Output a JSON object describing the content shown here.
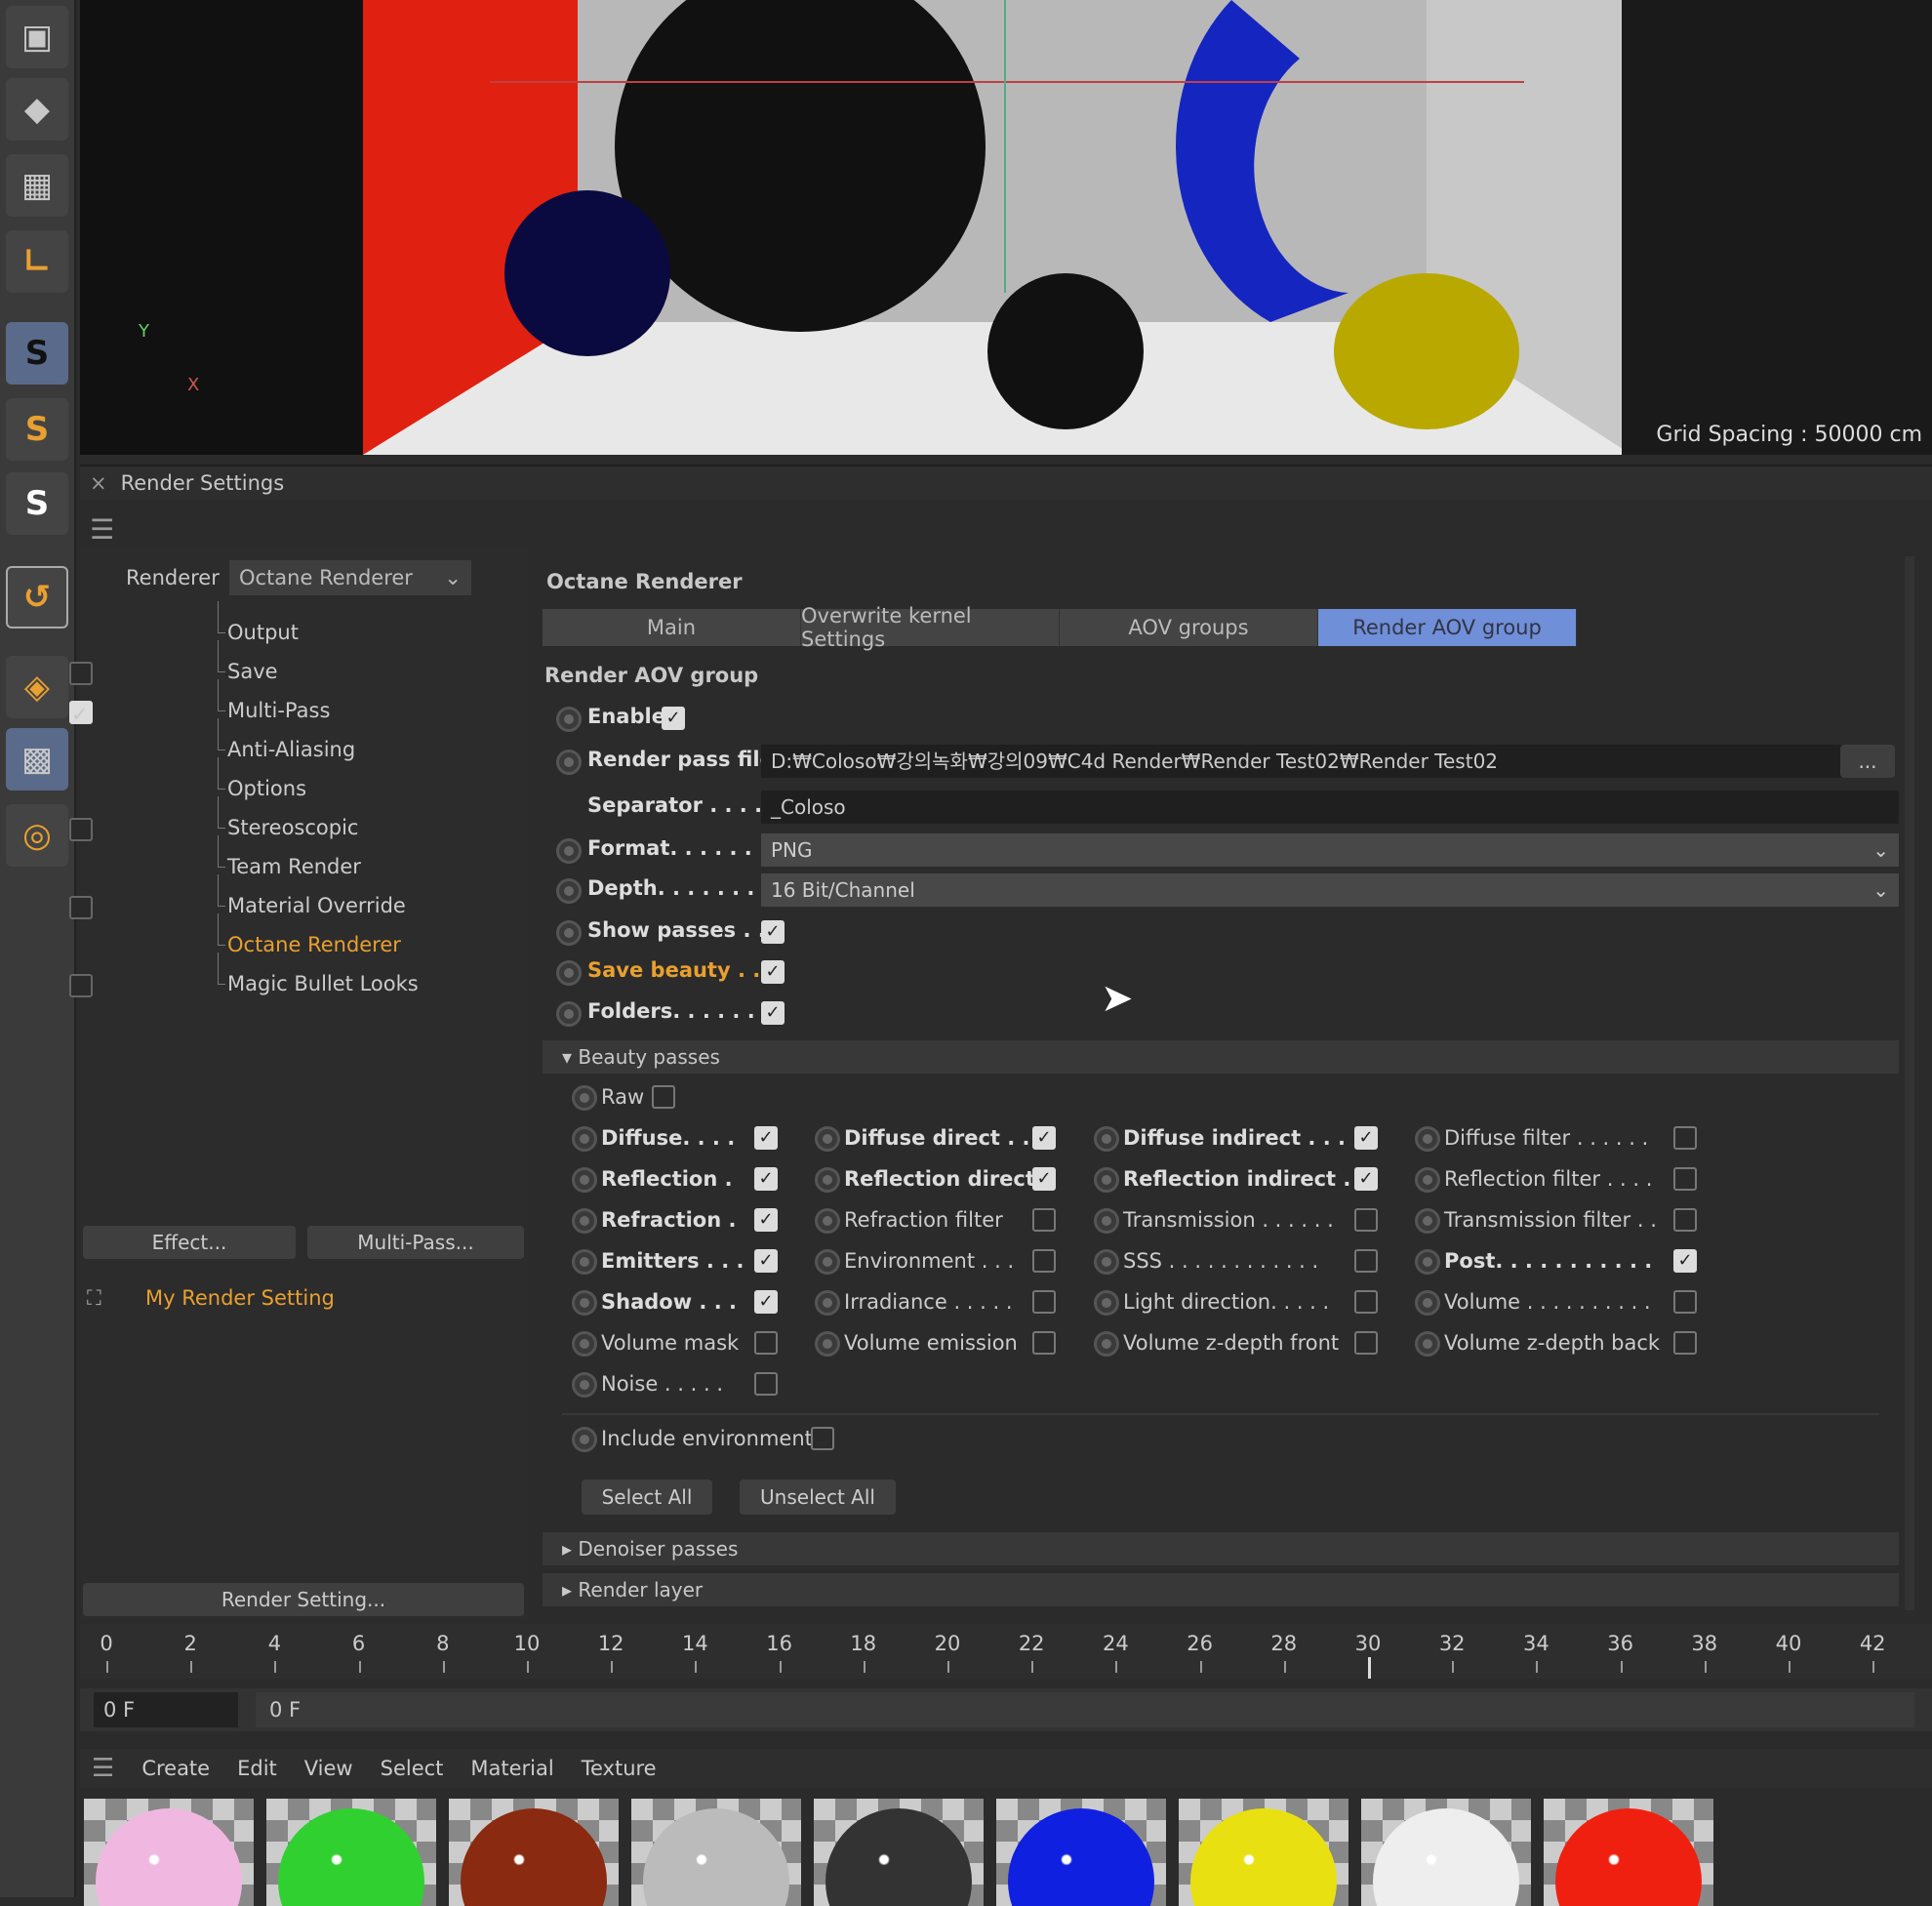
{
  "viewport": {
    "grid_spacing": "Grid Spacing : 50000 cm",
    "axis_x": "X",
    "axis_y": "Y"
  },
  "render_settings": {
    "title": "Render Settings",
    "close": "×",
    "renderer_label": "Renderer",
    "renderer_value": "Octane Renderer",
    "tree": [
      {
        "label": "Output",
        "checkbox": null
      },
      {
        "label": "Save",
        "checkbox": false
      },
      {
        "label": "Multi-Pass",
        "checkbox": true
      },
      {
        "label": "Anti-Aliasing",
        "checkbox": null
      },
      {
        "label": "Options",
        "checkbox": null
      },
      {
        "label": "Stereoscopic",
        "checkbox": false
      },
      {
        "label": "Team Render",
        "checkbox": null
      },
      {
        "label": "Material Override",
        "checkbox": false
      },
      {
        "label": "Octane Renderer",
        "checkbox": null,
        "active": true
      },
      {
        "label": "Magic Bullet Looks",
        "checkbox": false
      }
    ],
    "effect_button": "Effect...",
    "multipass_button": "Multi-Pass...",
    "setting_name": "My Render Setting",
    "render_setting_button": "Render Setting..."
  },
  "octane": {
    "title": "Octane Renderer",
    "tabs": [
      "Main",
      "Overwrite kernel Settings",
      "AOV groups",
      "Render AOV group"
    ],
    "active_tab": 3,
    "section": "Render AOV group",
    "enable": {
      "label": "Enable",
      "checked": true
    },
    "render_pass_file": {
      "label": "Render pass file",
      "value": "D:₩Coloso₩강의녹화₩강의09₩C4d Render₩Render Test02₩Render Test02",
      "browse": "..."
    },
    "separator": {
      "label": "Separator . . . . .",
      "value": "_Coloso"
    },
    "format": {
      "label": "Format. . . . . . .",
      "value": "PNG"
    },
    "depth": {
      "label": "Depth. . . . . . . .",
      "value": "16 Bit/Channel"
    },
    "show_passes": {
      "label": "Show passes . . .",
      "checked": true
    },
    "save_beauty": {
      "label": "Save beauty . . .",
      "checked": true
    },
    "folders": {
      "label": "Folders. . . . . . .",
      "checked": true
    },
    "beauty_title": "Beauty passes",
    "raw": {
      "label": "Raw",
      "checked": false
    },
    "passes": [
      [
        {
          "label": "Diffuse. . . .",
          "checked": true
        },
        {
          "label": "Diffuse direct . .",
          "checked": true
        },
        {
          "label": "Diffuse indirect . . .",
          "checked": true
        },
        {
          "label": "Diffuse filter . . . . . .",
          "checked": false
        }
      ],
      [
        {
          "label": "Reflection .",
          "checked": true
        },
        {
          "label": "Reflection direct",
          "checked": true
        },
        {
          "label": "Reflection indirect .",
          "checked": true
        },
        {
          "label": "Reflection filter . . . .",
          "checked": false
        }
      ],
      [
        {
          "label": "Refraction .",
          "checked": true
        },
        {
          "label": "Refraction filter",
          "checked": false
        },
        {
          "label": "Transmission . . . . . .",
          "checked": false
        },
        {
          "label": "Transmission filter . .",
          "checked": false
        }
      ],
      [
        {
          "label": "Emitters . . .",
          "checked": true
        },
        {
          "label": "Environment . . .",
          "checked": false
        },
        {
          "label": "SSS . . . . . . . . . . . .",
          "checked": false
        },
        {
          "label": "Post. . . . . . . . . . .",
          "checked": true
        }
      ],
      [
        {
          "label": "Shadow . . .",
          "checked": true
        },
        {
          "label": "Irradiance . . . . .",
          "checked": false
        },
        {
          "label": "Light direction. . . . .",
          "checked": false
        },
        {
          "label": "Volume . . . . . . . . . .",
          "checked": false
        }
      ],
      [
        {
          "label": "Volume mask",
          "checked": false
        },
        {
          "label": "Volume emission",
          "checked": false
        },
        {
          "label": "Volume z-depth front",
          "checked": false
        },
        {
          "label": "Volume z-depth back",
          "checked": false
        }
      ],
      [
        {
          "label": "Noise . . . . .",
          "checked": false
        }
      ]
    ],
    "include_env": {
      "label": "Include environment",
      "checked": false
    },
    "select_all": "Select All",
    "unselect_all": "Unselect All",
    "denoiser": "Denoiser passes",
    "render_layer": "Render layer"
  },
  "timeline": {
    "ticks": [
      "0",
      "2",
      "4",
      "6",
      "8",
      "10",
      "12",
      "14",
      "16",
      "18",
      "20",
      "22",
      "24",
      "26",
      "28",
      "30",
      "32",
      "34",
      "36",
      "38",
      "40",
      "42"
    ],
    "current_frame": "0 F",
    "frame_display": "0 F"
  },
  "materials": {
    "menu": [
      "Create",
      "Edit",
      "View",
      "Select",
      "Material",
      "Texture"
    ],
    "swatches": [
      "#f0b8e0",
      "#30d030",
      "#8a2a10",
      "#bbbbbb",
      "#333333",
      "#1020e0",
      "#e8e010",
      "#eeeeee",
      "#f02010"
    ]
  },
  "colors": {
    "accent": "#f0a030",
    "tab_active": "#6f8fd8"
  }
}
